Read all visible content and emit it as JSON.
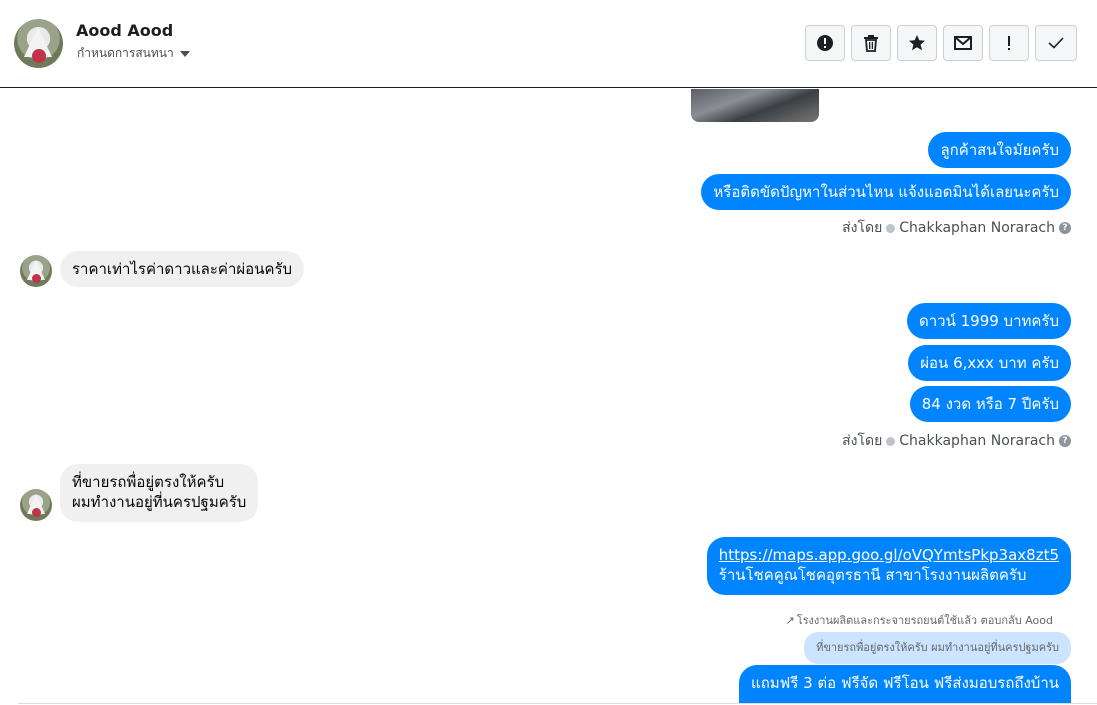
{
  "header": {
    "name": "Aood Aood",
    "subtitle": "กำหนดการสนทนา",
    "toolbar": {
      "spam_icon": "exclamation-circle-icon",
      "delete_icon": "trash-icon",
      "star_icon": "star-icon",
      "mail_icon": "envelope-icon",
      "important_icon": "exclamation-icon",
      "done_icon": "checkmark-icon"
    }
  },
  "messages": {
    "out1": "ลูกค้าสนใจมัยครับ",
    "out2": "หรือติดขัดปัญหาในส่วนไหน แจ้งแอดมินได้เลยนะครับ",
    "sent_label": "ส่งโดย",
    "sent_by": "Chakkaphan Norarach",
    "in1": "ราคาเท่าไรค่าดาวและค่าผ่อนครับ",
    "out3": "ดาวน์ 1999 บาทครับ",
    "out4": "ผ่อน 6,xxx บาท ครับ",
    "out5": "84 งวด หรือ 7 ปีครับ",
    "in2_line1": "ที่ขายรถพื่อยู่ตรงให้ครับ",
    "in2_line2": "ผมทำงานอยู่ที่นครปฐมครับ",
    "out6_link": "https://maps.app.goo.gl/oVQYmtsPkp3ax8zt5",
    "out6_text": "ร้านโชคคูณโชคอุตรธานี สาขาโรงงานผลิตครับ",
    "reply_note": "โรงงานผลิตและกระจายรถยนต์ใช้แล้ว ตอบกลับ Aood",
    "quoted": "ที่ขายรถพื่อยู่ตรงให้ครับ ผมทำงานอยู่ที่นครปฐมครับ",
    "out7": "แถมฟรี 3 ต่อ ฟรีจัด ฟรีโอน  ฟรีส่งมอบรถถึงบ้าน"
  }
}
